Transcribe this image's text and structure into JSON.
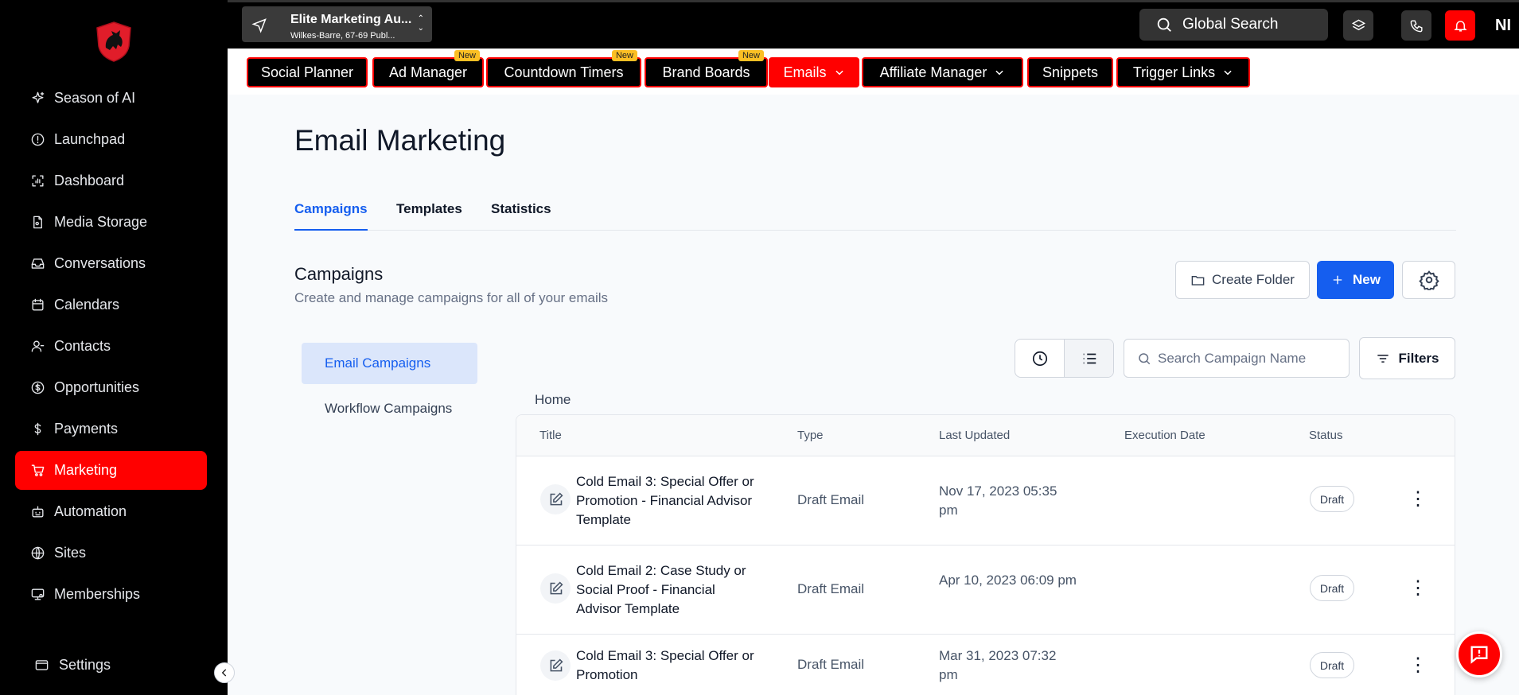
{
  "colors": {
    "brand_red": "#ff0000",
    "primary_blue": "#155eef",
    "sidebar_bg": "#000000"
  },
  "sidebar": {
    "items": [
      {
        "label": "Season of AI",
        "icon": "sparkle-icon"
      },
      {
        "label": "Launchpad",
        "icon": "launchpad-icon"
      },
      {
        "label": "Dashboard",
        "icon": "dashboard-icon"
      },
      {
        "label": "Media Storage",
        "icon": "file-icon"
      },
      {
        "label": "Conversations",
        "icon": "inbox-icon"
      },
      {
        "label": "Calendars",
        "icon": "calendar-icon"
      },
      {
        "label": "Contacts",
        "icon": "contact-icon"
      },
      {
        "label": "Opportunities",
        "icon": "dollar-circle-icon"
      },
      {
        "label": "Payments",
        "icon": "dollar-icon"
      },
      {
        "label": "Marketing",
        "icon": "cart-icon",
        "active": true
      },
      {
        "label": "Automation",
        "icon": "robot-icon"
      },
      {
        "label": "Sites",
        "icon": "globe-icon"
      },
      {
        "label": "Memberships",
        "icon": "monitor-user-icon"
      }
    ],
    "settings_label": "Settings"
  },
  "topbar": {
    "location_name": "Elite Marketing Au...",
    "location_address": "Wilkes-Barre, 67-69 Publ...",
    "global_search_label": "Global Search",
    "user_initials": "NI"
  },
  "tool_tabs": [
    {
      "label": "Social Planner"
    },
    {
      "label": "Ad Manager",
      "badge": "New"
    },
    {
      "label": "Countdown Timers",
      "badge": "New"
    },
    {
      "label": "Brand Boards",
      "badge": "New"
    },
    {
      "label": "Emails",
      "dropdown": true,
      "active": true
    },
    {
      "label": "Affiliate Manager",
      "dropdown": true
    },
    {
      "label": "Snippets"
    },
    {
      "label": "Trigger Links",
      "dropdown": true
    }
  ],
  "main": {
    "page_title": "Email Marketing",
    "tabs": [
      {
        "label": "Campaigns",
        "active": true
      },
      {
        "label": "Templates"
      },
      {
        "label": "Statistics"
      }
    ],
    "section_title": "Campaigns",
    "section_subtitle": "Create and manage campaigns for all of your emails",
    "create_folder_label": "Create Folder",
    "new_label": "New",
    "left_menu": [
      {
        "label": "Email Campaigns",
        "active": true
      },
      {
        "label": "Workflow Campaigns"
      }
    ],
    "search_placeholder": "Search Campaign Name",
    "filters_label": "Filters",
    "breadcrumb": "Home",
    "table": {
      "columns": [
        "Title",
        "Type",
        "Last Updated",
        "Execution Date",
        "Status"
      ],
      "rows": [
        {
          "title": "Cold Email 3: Special Offer or Promotion - Financial Advisor Template",
          "type": "Draft Email",
          "updated": "Nov 17, 2023 05:35 pm",
          "execution": "",
          "status": "Draft"
        },
        {
          "title": "Cold Email 2: Case Study or Social Proof - Financial Advisor Template",
          "type": "Draft Email",
          "updated": "Apr 10, 2023 06:09 pm",
          "execution": "",
          "status": "Draft"
        },
        {
          "title": "Cold Email 3: Special Offer or Promotion",
          "type": "Draft Email",
          "updated": "Mar 31, 2023 07:32 pm",
          "execution": "",
          "status": "Draft"
        }
      ]
    }
  }
}
